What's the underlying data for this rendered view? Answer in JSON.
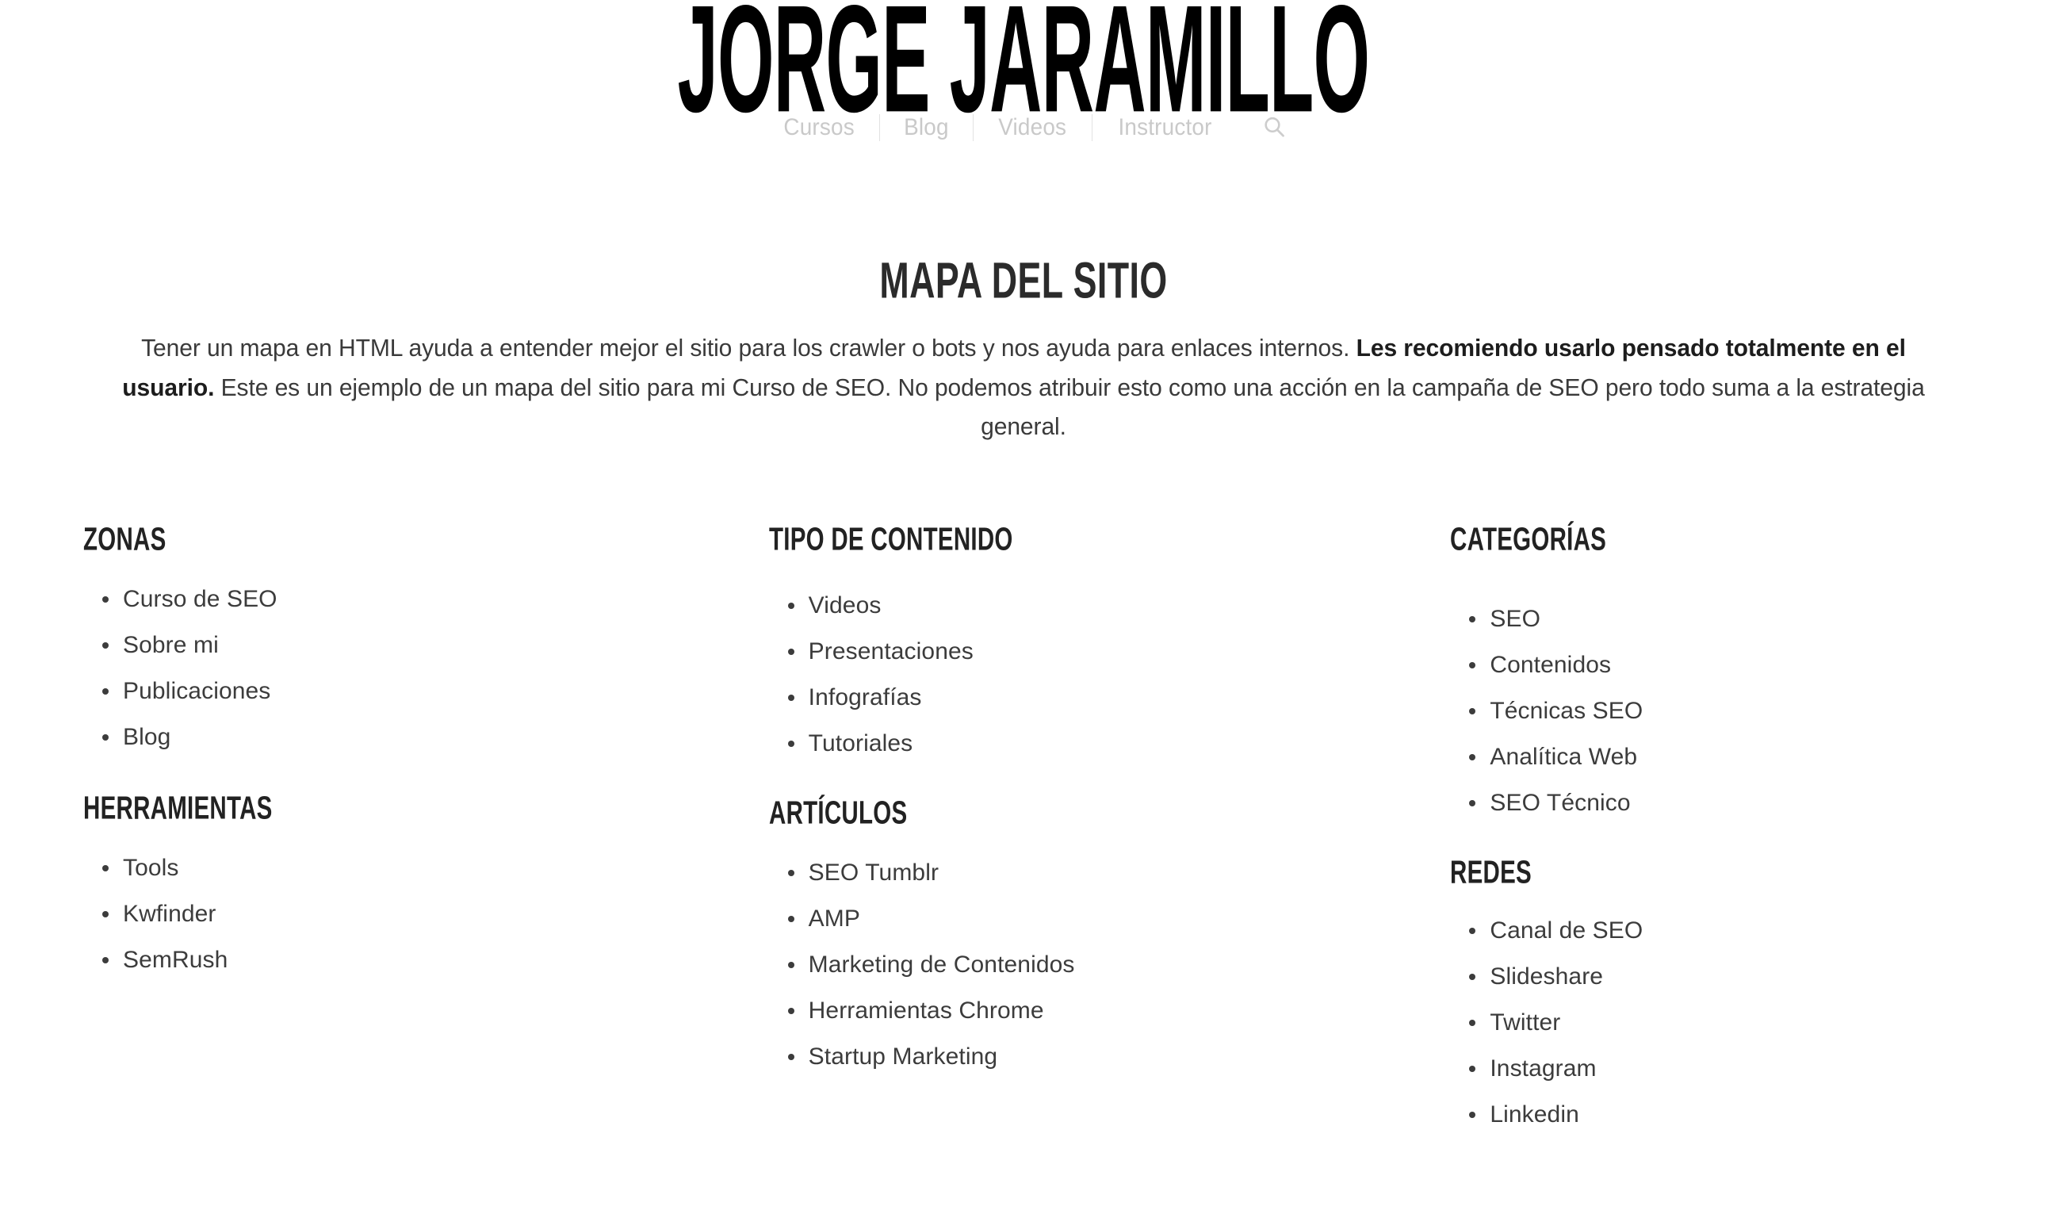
{
  "site": {
    "title": "JORGE JARAMILLO"
  },
  "nav": {
    "items": [
      {
        "label": "Cursos"
      },
      {
        "label": "Blog"
      },
      {
        "label": "Videos"
      },
      {
        "label": "Instructor"
      }
    ],
    "search_icon": "search-icon"
  },
  "page": {
    "title": "MAPA DEL SITIO",
    "intro": {
      "part1": "Tener un mapa en HTML ayuda a entender mejor el sitio para los crawler o bots y nos ayuda para enlaces internos. ",
      "emphasis": "Les recomiendo usarlo pensado totalmente en el usuario.",
      "part2": " Este es un ejemplo de un mapa del sitio para mi Curso de SEO. No podemos atribuir esto como una acción en la campaña de SEO pero todo suma a la estrategia general."
    }
  },
  "colors": {
    "text": "#3c3c3c",
    "heading": "#222222",
    "nav": "#c9c9c9",
    "background": "#ffffff"
  },
  "sitemap": {
    "columns": [
      {
        "groups": [
          {
            "heading": "ZONAS",
            "items": [
              "Curso de SEO",
              "Sobre mi",
              "Publicaciones",
              "Blog"
            ]
          },
          {
            "heading": "HERRAMIENTAS",
            "items": [
              "Tools",
              "Kwfinder",
              "SemRush"
            ]
          }
        ]
      },
      {
        "groups": [
          {
            "heading": "TIPO DE CONTENIDO",
            "items": [
              "Videos",
              "Presentaciones",
              "Infografías",
              "Tutoriales"
            ]
          },
          {
            "heading": "ARTÍCULOS",
            "items": [
              "SEO Tumblr",
              "AMP",
              "Marketing de Contenidos",
              "Herramientas Chrome",
              "Startup Marketing"
            ]
          }
        ]
      },
      {
        "groups": [
          {
            "heading": "CATEGORÍAS",
            "items": [
              "SEO",
              "Contenidos",
              "Técnicas SEO",
              "Analítica Web",
              "SEO Técnico"
            ]
          },
          {
            "heading": "REDES",
            "items": [
              "Canal de SEO",
              "Slideshare",
              "Twitter",
              "Instagram",
              "Linkedin"
            ]
          }
        ]
      }
    ]
  }
}
